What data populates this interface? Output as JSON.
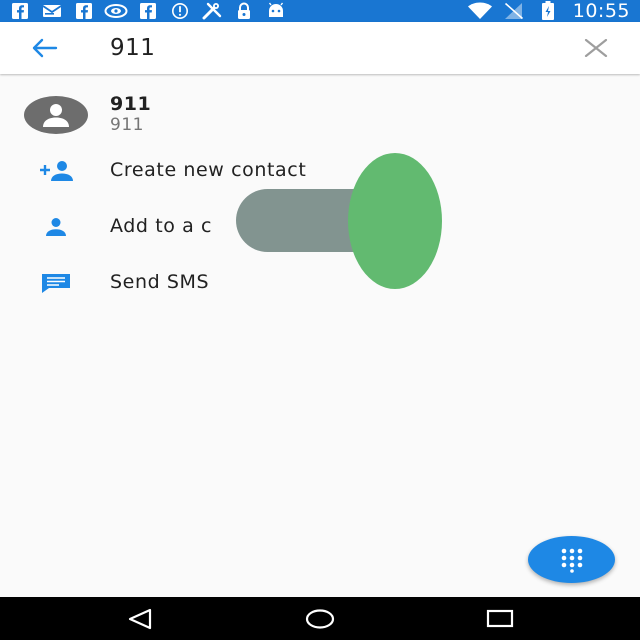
{
  "status_bar": {
    "time": "10:55",
    "notification_icons": [
      "facebook-icon",
      "mail-icon",
      "facebook-icon",
      "nvidia-icon",
      "facebook-icon",
      "sync-icon",
      "tools-icon",
      "lock-icon",
      "android-icon"
    ],
    "system_icons": [
      "wifi-icon",
      "signal-off-icon",
      "battery-charging-icon"
    ],
    "background_color": "#1976d2"
  },
  "search": {
    "value": "911",
    "back_icon": "arrow-back-icon",
    "clear_icon": "close-icon"
  },
  "contact": {
    "name": "911",
    "number": "911",
    "avatar_icon": "person-icon"
  },
  "actions": [
    {
      "label": "Create new contact",
      "icon": "person-add-icon"
    },
    {
      "label": "Add to a c",
      "icon": "person-icon"
    },
    {
      "label": "Send SMS",
      "icon": "message-icon"
    }
  ],
  "fab": {
    "icon": "dialpad-icon",
    "color": "#1e88e5"
  },
  "nav": {
    "back_icon": "nav-back-icon",
    "home_icon": "nav-home-icon",
    "recents_icon": "nav-recents-icon"
  },
  "accent_color": "#1e88e5"
}
